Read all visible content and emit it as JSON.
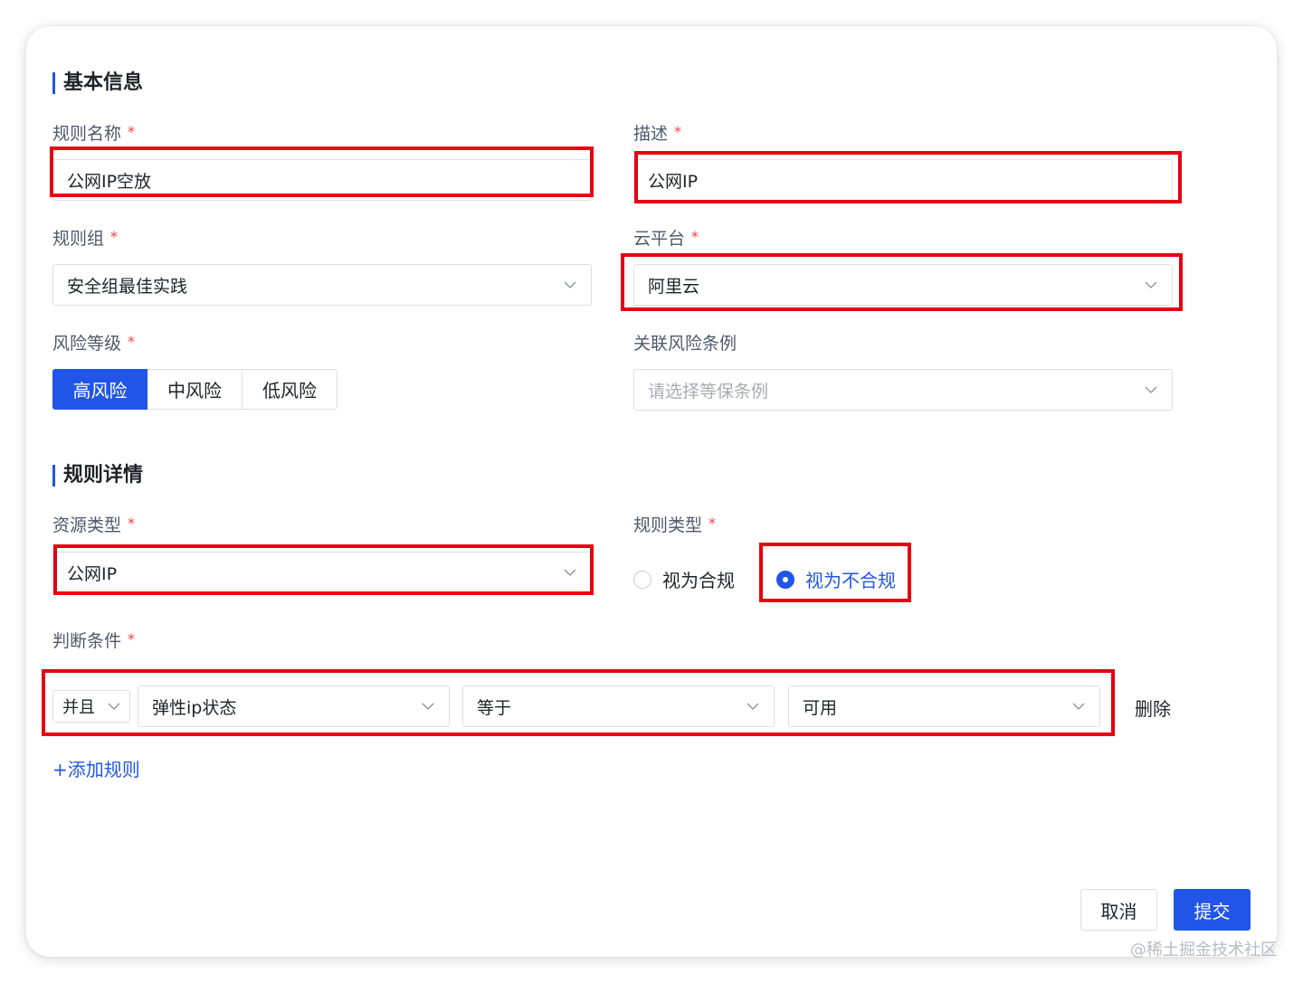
{
  "basic_info": {
    "title": "基本信息",
    "rule_name": {
      "label": "规则名称",
      "required_mark": "*",
      "value": "公网IP空放"
    },
    "description": {
      "label": "描述",
      "required_mark": "*",
      "value": "公网IP"
    },
    "rule_group": {
      "label": "规则组",
      "required_mark": "*",
      "value": "安全组最佳实践"
    },
    "cloud_platform": {
      "label": "云平台",
      "required_mark": "*",
      "value": "阿里云"
    },
    "risk_level": {
      "label": "风险等级",
      "required_mark": "*",
      "options": [
        "高风险",
        "中风险",
        "低风险"
      ],
      "selected": "高风险"
    },
    "related_regulation": {
      "label": "关联风险条例",
      "placeholder": "请选择等保条例"
    }
  },
  "rule_details": {
    "title": "规则详情",
    "resource_type": {
      "label": "资源类型",
      "required_mark": "*",
      "value": "公网IP"
    },
    "rule_type": {
      "label": "规则类型",
      "required_mark": "*",
      "options": [
        "视为合规",
        "视为不合规"
      ],
      "selected": "视为不合规"
    },
    "conditions": {
      "label": "判断条件",
      "required_mark": "*",
      "rows": [
        {
          "logic": "并且",
          "field": "弹性ip状态",
          "operator": "等于",
          "value": "可用",
          "delete_label": "删除"
        }
      ],
      "add_label": "+添加规则"
    }
  },
  "footer": {
    "cancel_label": "取消",
    "submit_label": "提交"
  },
  "watermark": "@稀土掘金技术社区",
  "colors": {
    "primary": "#2155e8",
    "highlight_box": "#e60012",
    "required": "#f53f3f"
  }
}
